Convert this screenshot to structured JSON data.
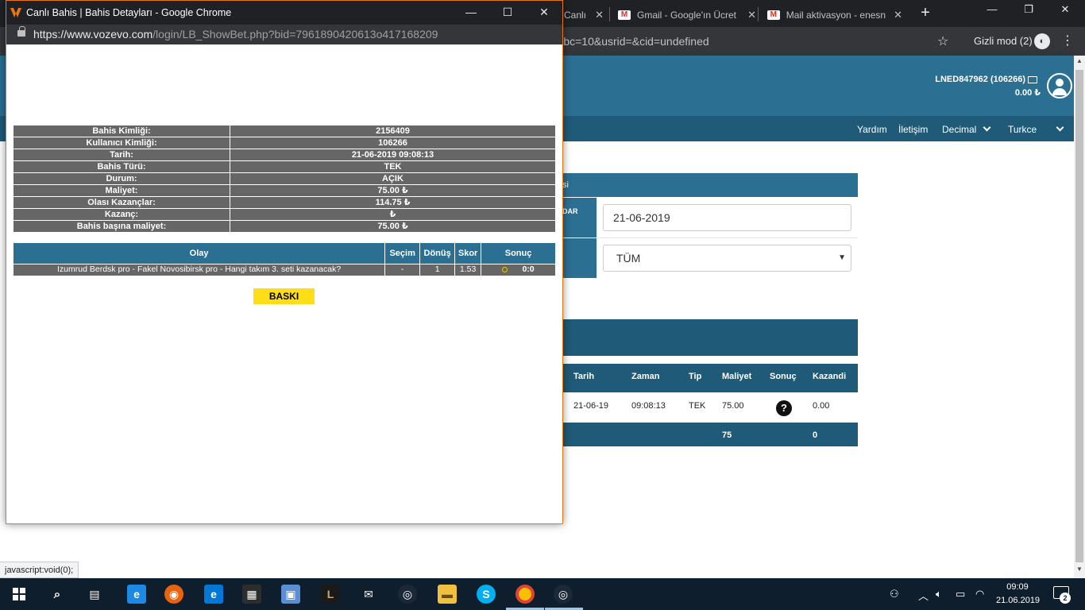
{
  "background_browser": {
    "tabs": [
      {
        "label": "Canlı",
        "close": "✕"
      },
      {
        "label": "Gmail - Google'ın Ücret",
        "close": "✕"
      },
      {
        "label": "Mail aktivasyon - enesn",
        "close": "✕"
      }
    ],
    "new_tab": "+",
    "url_suffix": "&bc=10&usrid=&cid=undefined",
    "incognito_label": "Gizli mod (2)",
    "window_controls": {
      "minimize": "—",
      "restore": "❐",
      "close": "✕"
    }
  },
  "site": {
    "user": "LNED847962 (106266)",
    "balance": "0.00 ₺",
    "nav": [
      {
        "label": "Yardım"
      },
      {
        "label": "İletişim"
      },
      {
        "label": "Decimal"
      },
      {
        "label": "Turkce"
      }
    ],
    "form": {
      "title_fragment": "si",
      "label_fragment": "DAR",
      "date_value": "21-06-2019",
      "select_value": "TÜM"
    },
    "results": {
      "headers": [
        "Tarih",
        "Zaman",
        "Tip",
        "Maliyet",
        "Sonuç",
        "Kazandi"
      ],
      "row": {
        "date": "21-06-19",
        "time": "09:08:13",
        "type": "TEK",
        "cost": "75.00",
        "won": "0.00"
      },
      "footer": {
        "cost": "75",
        "won": "0"
      }
    },
    "status_tip": "javascript:void(0);"
  },
  "popup": {
    "title": "Canlı Bahis | Bahis Detayları - Google Chrome",
    "url_host": "https://www.vozevo.com",
    "url_path": "/login/LB_ShowBet.php?bid=7961890420613o417168209",
    "controls": {
      "minimize": "—",
      "maximize": "☐",
      "close": "✕"
    },
    "details": [
      {
        "label": "Bahis Kimliği:",
        "value": "2156409"
      },
      {
        "label": "Kullanıcı Kimliği:",
        "value": "106266"
      },
      {
        "label": "Tarih:",
        "value": "21-06-2019 09:08:13"
      },
      {
        "label": "Bahis Türü:",
        "value": "TEK"
      },
      {
        "label": "Durum:",
        "value": "AÇIK"
      },
      {
        "label": "Maliyet:",
        "value": "75.00 ₺"
      },
      {
        "label": "Olası Kazançlar:",
        "value": "114.75 ₺"
      },
      {
        "label": "Kazanç:",
        "value": "₺"
      },
      {
        "label": "Bahis başına maliyet:",
        "value": "75.00 ₺"
      }
    ],
    "event_headers": [
      "Olay",
      "Seçim",
      "Dönüş",
      "Skor",
      "Sonuç"
    ],
    "event": {
      "name": "Izumrud Berdsk pro - Fakel Novosibirsk pro - Hangi takım 3. seti kazanacak?",
      "selection": "-",
      "return": "1",
      "odds": "1.53",
      "result": "0:0"
    },
    "print_button": "BASKI"
  },
  "taskbar": {
    "time": "09:09",
    "date": "21.06.2019",
    "notifications": "2"
  },
  "colors": {
    "header_blue": "#2b6f92",
    "nav_blue": "#1f5a78",
    "print_yellow": "#ffde17",
    "popup_border": "#e8780d"
  }
}
